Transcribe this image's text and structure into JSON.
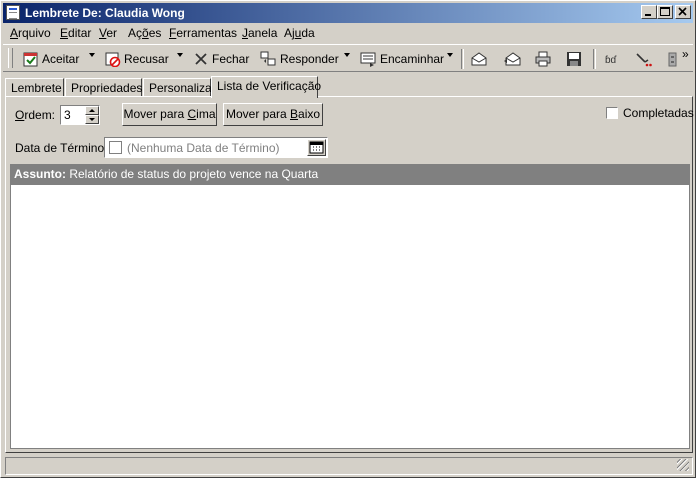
{
  "window": {
    "title": "Lembrete De: Claudia Wong"
  },
  "menu": [
    {
      "label": "Arquivo",
      "key": "A"
    },
    {
      "label": "Editar",
      "key": "E"
    },
    {
      "label": "Ver",
      "key": "V"
    },
    {
      "label": "Ações",
      "key": "õ"
    },
    {
      "label": "Ferramentas",
      "key": "F"
    },
    {
      "label": "Janela",
      "key": "J"
    },
    {
      "label": "Ajuda",
      "key": "u"
    }
  ],
  "toolbar": {
    "accept": "Aceitar",
    "decline": "Recusar",
    "close": "Fechar",
    "reply": "Responder",
    "forward": "Encaminhar",
    "more": "»"
  },
  "tabs": [
    {
      "label": "Lembrete"
    },
    {
      "label": "Propriedades"
    },
    {
      "label": "Personalizar"
    },
    {
      "label": "Lista de Verificação",
      "active": true
    }
  ],
  "form": {
    "order_label": "Ordem:",
    "order_value": "3",
    "move_up": "Mover para Cima",
    "move_down": "Mover para Baixo",
    "completed_label": "Completadas",
    "due_date_label": "Data de Término:",
    "due_date_placeholder": "(Nenhuma Data de Término)"
  },
  "subject": {
    "label": "Assunto:",
    "value": "Relatório de status do projeto vence na Quarta"
  },
  "colors": {
    "title_start": "#0a246a",
    "title_end": "#a6caf0",
    "chrome": "#d4d0c8",
    "subject_bar": "#808080"
  }
}
